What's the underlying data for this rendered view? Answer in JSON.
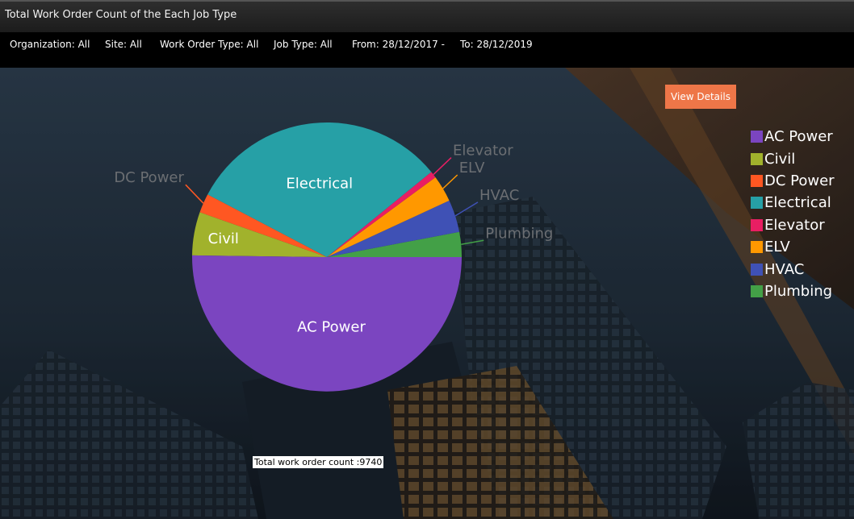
{
  "header": {
    "title": "Total Work Order Count of the Each Job Type"
  },
  "filters": [
    "Organization: All",
    "Site: All",
    "Work Order Type: All",
    "Job Type: All",
    "From: 28/12/2017 -",
    "To: 28/12/2019"
  ],
  "view_details_label": "View Details",
  "total_label": "Total work order count :9740",
  "chart_data": {
    "type": "pie",
    "title": "",
    "total": 9740,
    "slices": [
      {
        "label": "Plumbing",
        "percent": 3.0,
        "color": "#43a047"
      },
      {
        "label": "HVAC",
        "percent": 3.9,
        "color": "#3f51b5"
      },
      {
        "label": "ELV",
        "percent": 3.2,
        "color": "#ff9800"
      },
      {
        "label": "Elevator",
        "percent": 0.8,
        "color": "#e91e63"
      },
      {
        "label": "Electrical",
        "percent": 31.4,
        "color": "#26a0a6"
      },
      {
        "label": "DC Power",
        "percent": 2.3,
        "color": "#ff5722"
      },
      {
        "label": "Civil",
        "percent": 5.2,
        "color": "#a1b22c"
      },
      {
        "label": "AC Power",
        "percent": 50.2,
        "color": "#7b45c0"
      }
    ],
    "legend": [
      "AC Power",
      "Civil",
      "DC Power",
      "Electrical",
      "Elevator",
      "ELV",
      "HVAC",
      "Plumbing"
    ],
    "legend_placement": "right",
    "inside_labels": [
      "Electrical",
      "Civil",
      "AC Power"
    ],
    "outside_labels": [
      "DC Power",
      "Elevator",
      "ELV",
      "HVAC",
      "Plumbing"
    ]
  }
}
